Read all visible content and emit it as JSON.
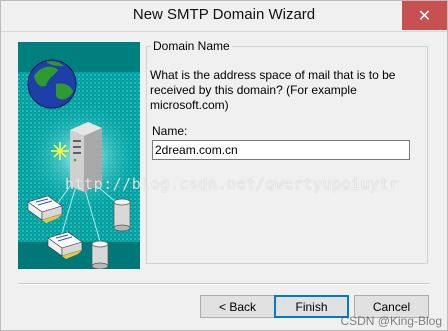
{
  "window": {
    "title": "New SMTP Domain Wizard",
    "close_glyph": "✕"
  },
  "group": {
    "legend": "Domain Name",
    "prompt": "What is the address space of mail that is to be received by this domain? (For example microsoft.com)",
    "name_label": "Name:",
    "name_value": "2dream.com.cn"
  },
  "buttons": {
    "back": "< Back",
    "finish": "Finish",
    "cancel": "Cancel"
  },
  "watermark": "http://blog.csdn.net/qwertyupoiuytr",
  "footer_credit": "CSDN @King-Blog",
  "colors": {
    "art_background": "#00aaaa",
    "close_button": "#c75050",
    "default_button_border": "#0078d7"
  },
  "icons": [
    "globe-icon",
    "server-icon",
    "mail-envelope-icon",
    "database-cylinder-icon",
    "sparkle-icon"
  ]
}
